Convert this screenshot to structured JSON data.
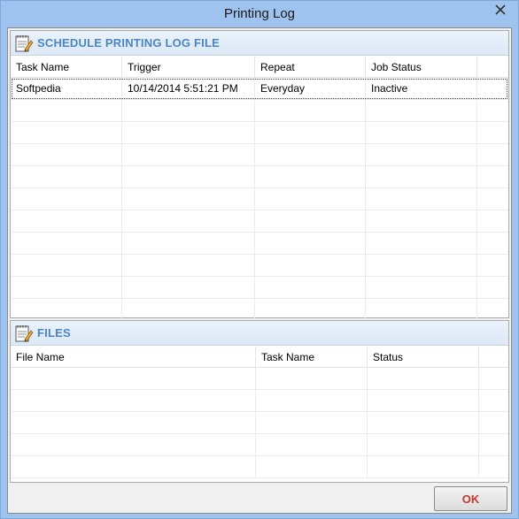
{
  "window": {
    "title": "Printing Log"
  },
  "schedule": {
    "header": "SCHEDULE PRINTING LOG FILE",
    "columns": [
      "Task Name",
      "Trigger",
      "Repeat",
      "Job Status"
    ],
    "rows": [
      {
        "task_name": "Softpedia",
        "trigger": "10/14/2014 5:51:21 PM",
        "repeat": "Everyday",
        "job_status": "Inactive"
      }
    ]
  },
  "files": {
    "header": "FILES",
    "columns": [
      "File Name",
      "Task Name",
      "Status"
    ]
  },
  "buttons": {
    "ok": "OK"
  },
  "colors": {
    "header_text": "#4a86c2",
    "ok_text": "#c0392b",
    "frame": "#9ec3ef",
    "close": "#c0392b"
  }
}
